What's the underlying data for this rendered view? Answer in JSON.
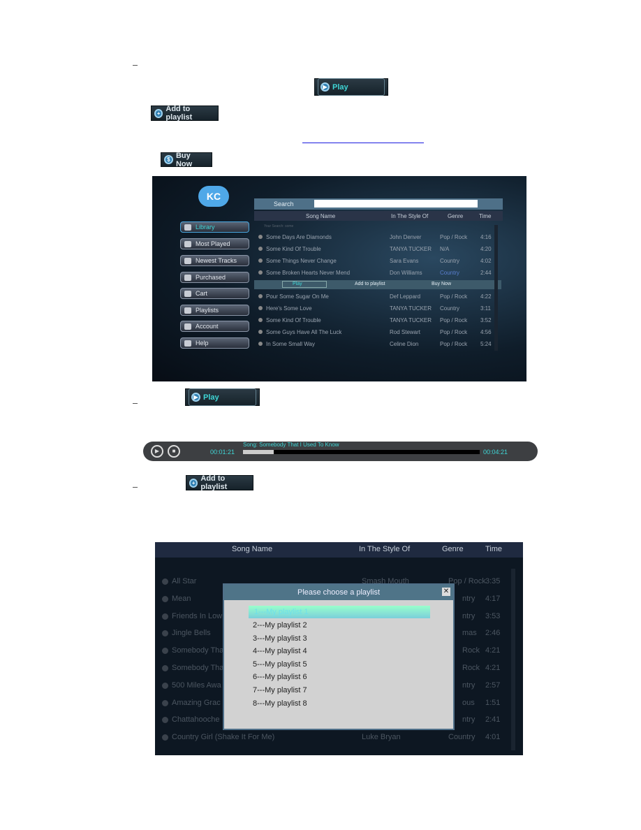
{
  "doc": {
    "buttons": {
      "play": "Play",
      "add": "Add to playlist",
      "buy": "Buy Now"
    }
  },
  "app": {
    "logo": "KC",
    "search_label": "Search",
    "search_value": "",
    "columns": [
      "Song Name",
      "In The Style Of",
      "Genre",
      "Time"
    ],
    "search_hint": "Your Search: some",
    "sidebar": [
      "Library",
      "Most Played",
      "Newest Tracks",
      "Purchased",
      "Cart",
      "Playlists",
      "Account",
      "Help"
    ],
    "rows_top": [
      [
        "Some Days Are Diamonds",
        "John Denver",
        "Pop / Rock",
        "4:16"
      ],
      [
        "Some Kind Of Trouble",
        "TANYA TUCKER",
        "N/A",
        "4:20"
      ],
      [
        "Some Things Never Change",
        "Sara Evans",
        "Country",
        "4:02"
      ],
      [
        "Some Broken Hearts Never Mend",
        "Don Williams",
        "Country",
        "2:44"
      ]
    ],
    "actions": [
      "Play",
      "Add to playlist",
      "Buy Now"
    ],
    "rows_bottom": [
      [
        "Pour Some Sugar On Me",
        "Def Leppard",
        "Pop / Rock",
        "4:22"
      ],
      [
        "Here's Some Love",
        "TANYA TUCKER",
        "Country",
        "3:11"
      ],
      [
        "Some Kind Of Trouble",
        "TANYA TUCKER",
        "Pop / Rock",
        "3:52"
      ],
      [
        "Some Guys Have All The Luck",
        "Rod Stewart",
        "Pop / Rock",
        "4:56"
      ],
      [
        "In Some Small Way",
        "Celine Dion",
        "Pop / Rock",
        "5:24"
      ]
    ]
  },
  "player": {
    "song": "Song: Somebody That I Used To Know",
    "elapsed": "00:01:21",
    "total": "00:04:21",
    "progress": 0.13
  },
  "list2": {
    "columns": [
      "Song Name",
      "In The Style Of",
      "Genre",
      "Time"
    ],
    "rows": [
      [
        "All Star",
        "Smash Mouth",
        "Pop / Rock",
        "3:35"
      ],
      [
        "Mean",
        "",
        "ntry",
        "4:17"
      ],
      [
        "Friends In Low",
        "",
        "ntry",
        "3:53"
      ],
      [
        "Jingle Bells",
        "",
        "mas",
        "2:46"
      ],
      [
        "Somebody Tha",
        "",
        "Rock",
        "4:21"
      ],
      [
        "Somebody Tha",
        "",
        "Rock",
        "4:21"
      ],
      [
        "500 Miles Awa",
        "",
        "ntry",
        "2:57"
      ],
      [
        "Amazing Grac",
        "",
        "ous",
        "1:51"
      ],
      [
        "Chattahooche",
        "",
        "ntry",
        "2:41"
      ],
      [
        "Country Girl (Shake It For Me)",
        "Luke Bryan",
        "Country",
        "4:01"
      ]
    ],
    "modal": {
      "title": "Please choose a playlist",
      "selected": "1---My playlist 1",
      "items": [
        "2---My playlist 2",
        "3---My playlist 3",
        "4---My playlist 4",
        "5---My playlist 5",
        "6---My playlist 6",
        "7---My playlist 7",
        "8---My playlist 8"
      ]
    }
  }
}
